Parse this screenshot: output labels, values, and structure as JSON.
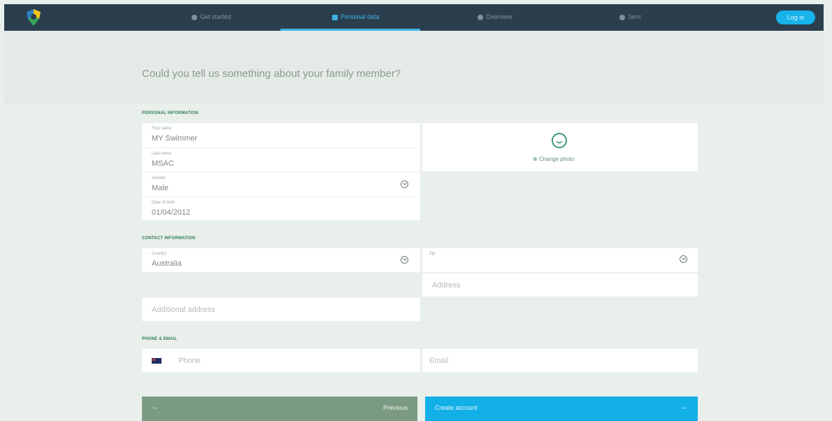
{
  "header": {
    "steps": [
      {
        "label": "Get started",
        "active": false
      },
      {
        "label": "Personal data",
        "active": true
      },
      {
        "label": "Overview",
        "active": false
      },
      {
        "label": "Sent",
        "active": false
      }
    ],
    "login_label": "Log in"
  },
  "question": "Could you tell us something about your family member?",
  "personal": {
    "section_label": "PERSONAL INFORMATION",
    "first_name": {
      "label": "First name",
      "value": "MY Swimmer"
    },
    "last_name": {
      "label": "Last name",
      "value": "MSAC"
    },
    "gender": {
      "label": "Gender",
      "value": "Male"
    },
    "dob": {
      "label": "Date of birth",
      "value": "01/04/2012"
    },
    "change_photo": "⊕ Change photo"
  },
  "contact": {
    "section_label": "CONTACT INFORMATION",
    "country": {
      "label": "Country",
      "value": "Australia"
    },
    "zip": {
      "label": "Zip",
      "value": ""
    },
    "address_placeholder": "Address",
    "additional_address_placeholder": "Additional address"
  },
  "phone_email": {
    "section_label": "PHONE & EMAIL",
    "phone_placeholder": "Phone",
    "email_placeholder": "Email"
  },
  "buttons": {
    "previous": "Previous",
    "create": "Create account",
    "prev_arrow": "←",
    "next_arrow": "→"
  },
  "colors": {
    "topbar": "#2b3e4e",
    "accent": "#13b0e7",
    "section_label": "#2e7a5a",
    "previous_button": "#7a9a82"
  }
}
